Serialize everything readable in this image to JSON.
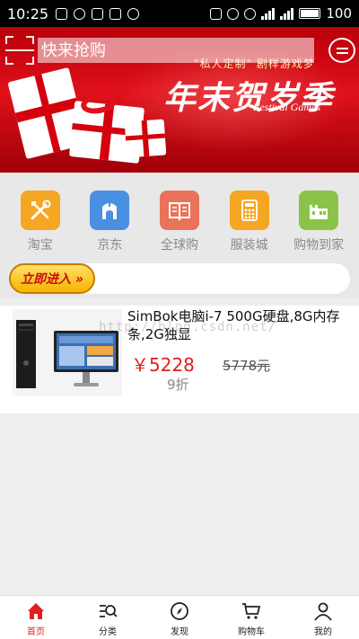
{
  "status_bar": {
    "time": "10:25",
    "battery": "100"
  },
  "header": {
    "search_placeholder": "快来抢购"
  },
  "banner": {
    "topline": "\"私人定制\" 剧样游戏梦",
    "title": "年末贺岁季",
    "subtitle": "Festival Games"
  },
  "categories": [
    {
      "label": "淘宝",
      "color": "#f5a623",
      "icon": "tools-icon"
    },
    {
      "label": "京东",
      "color": "#4a90e2",
      "icon": "jd-bag-icon"
    },
    {
      "label": "全球购",
      "color": "#e8735a",
      "icon": "book-icon"
    },
    {
      "label": "服装城",
      "color": "#f5a623",
      "icon": "calculator-icon"
    },
    {
      "label": "购物到家",
      "color": "#8bc34a",
      "icon": "castle-icon"
    }
  ],
  "enter_button": {
    "label": "立即进入 »"
  },
  "product": {
    "title": "SimBok电脑i-7 500G硬盘,8G内存条,2G独显",
    "price": "￥5228",
    "original_price": "5778元",
    "discount": "9折",
    "watermark": "http://blog.csdn.net/"
  },
  "bottom_nav": [
    {
      "label": "首页",
      "icon": "home-icon",
      "active": true
    },
    {
      "label": "分类",
      "icon": "category-search-icon",
      "active": false
    },
    {
      "label": "发现",
      "icon": "compass-icon",
      "active": false
    },
    {
      "label": "购物车",
      "icon": "cart-icon",
      "active": false
    },
    {
      "label": "我的",
      "icon": "user-icon",
      "active": false
    }
  ],
  "colors": {
    "accent_red": "#e02020",
    "banner_red": "#d4000c"
  }
}
